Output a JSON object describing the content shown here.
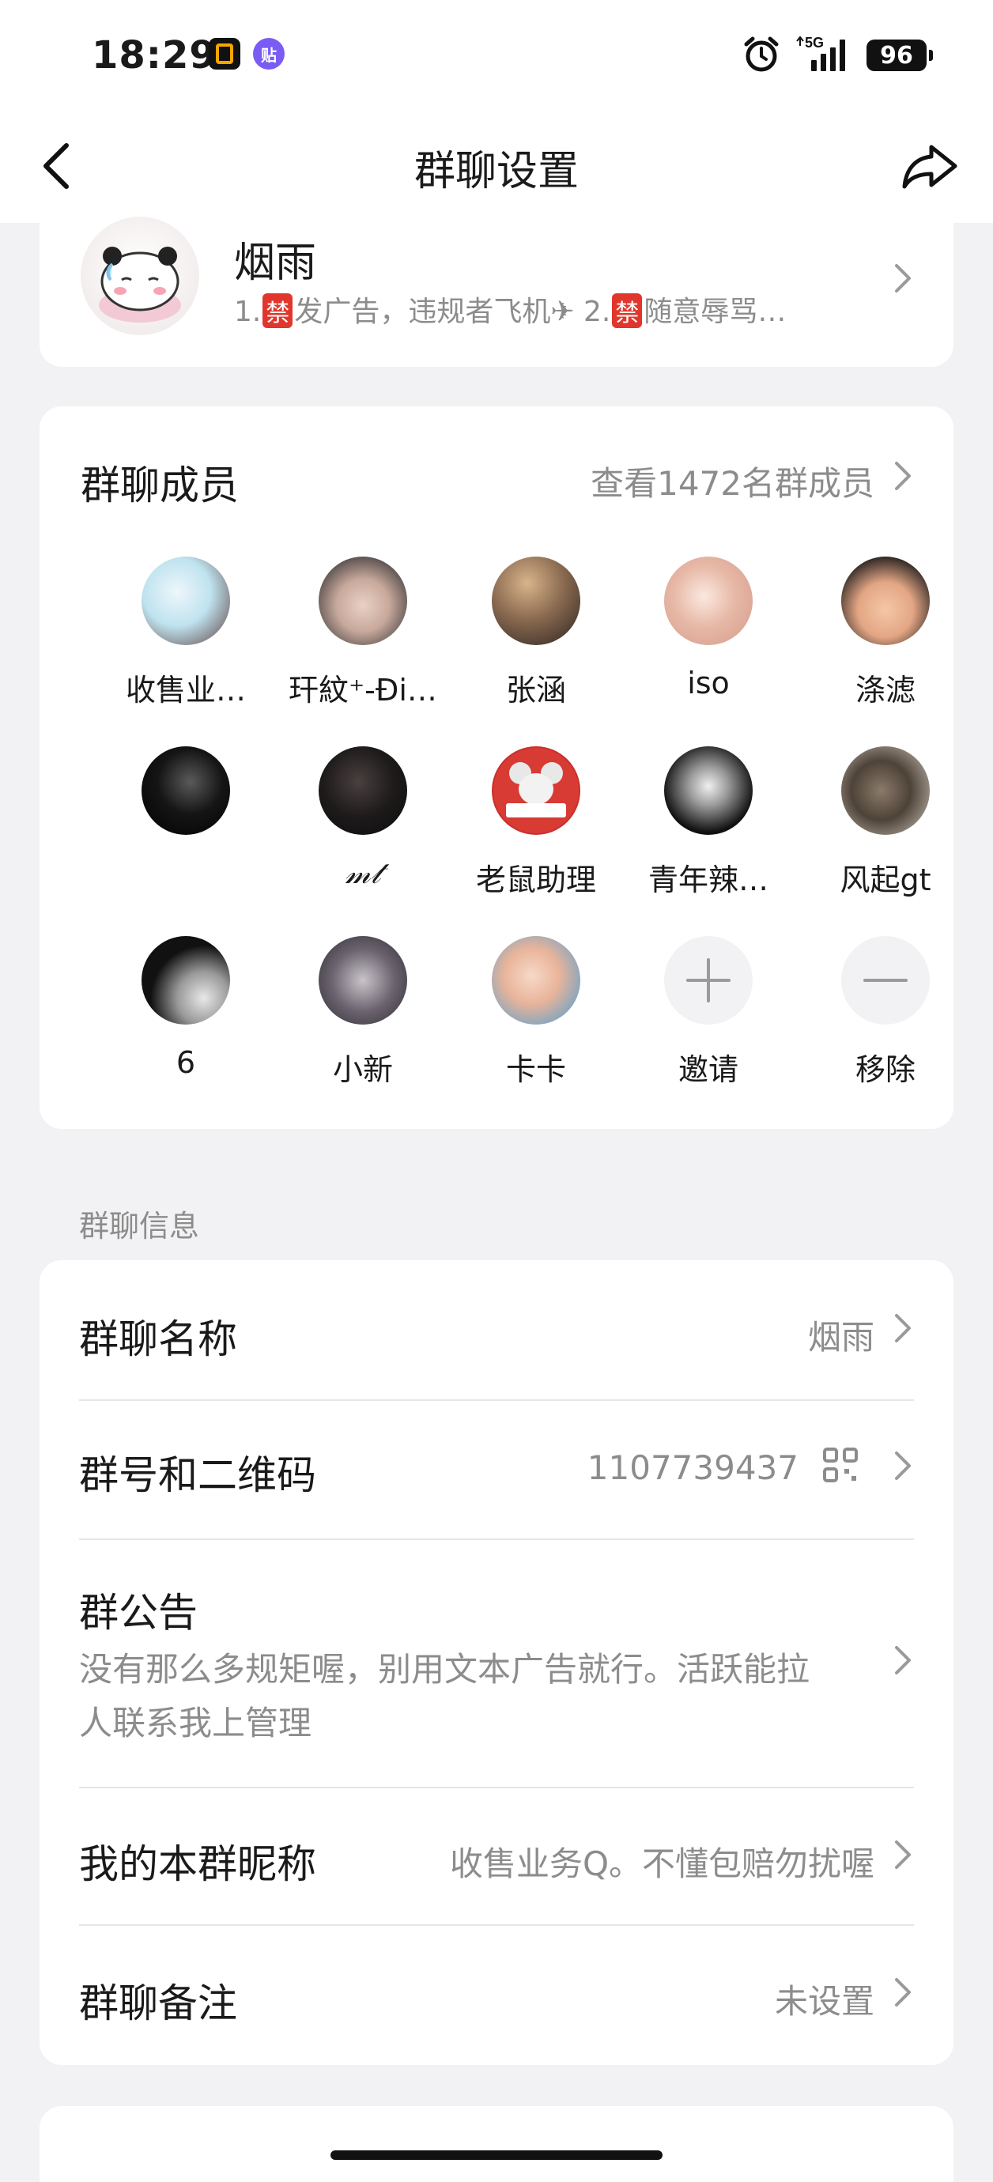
{
  "status": {
    "time": "18:29",
    "battery": "96",
    "network": "5G",
    "badge2": "贴"
  },
  "nav": {
    "title": "群聊设置"
  },
  "group": {
    "name": "烟雨",
    "desc_1": "1.",
    "ban": "禁",
    "desc_2": "发广告，违规者飞机",
    "desc_3": " 2.",
    "desc_4": "随意辱骂…"
  },
  "members": {
    "title": "群聊成员",
    "view_all": "查看1472名群成员",
    "list": [
      {
        "name": "收售业…",
        "icon": "anime-avatar"
      },
      {
        "name": "玕紋⁺-Đi…",
        "icon": "photo-avatar"
      },
      {
        "name": "张涵",
        "icon": "photo-avatar"
      },
      {
        "name": "iso",
        "icon": "anime-avatar"
      },
      {
        "name": "涤滤",
        "icon": "comic-avatar"
      },
      {
        "name": "",
        "icon": "dark-avatar"
      },
      {
        "name": "𝓂𝓉",
        "icon": "dark-avatar"
      },
      {
        "name": "老鼠助理",
        "icon": "mouse-avatar"
      },
      {
        "name": "青年辣…",
        "icon": "anime-avatar"
      },
      {
        "name": "风起gt",
        "icon": "photo-avatar"
      },
      {
        "name": "6",
        "icon": "silhouette-avatar"
      },
      {
        "name": "小新",
        "icon": "anime-avatar"
      },
      {
        "name": "卡卡",
        "icon": "baby-avatar"
      },
      {
        "name": "邀请",
        "icon": "plus-icon"
      },
      {
        "name": "移除",
        "icon": "minus-icon"
      }
    ]
  },
  "info": {
    "section_label": "群聊信息",
    "name_label": "群聊名称",
    "name_value": "烟雨",
    "id_label": "群号和二维码",
    "id_value": "1107739437",
    "notice_label": "群公告",
    "notice_line1": "没有那么多规矩喔，别用文本广告就行。活跃能拉",
    "notice_line2": "人联系我上管理",
    "nickname_label": "我的本群昵称",
    "nickname_value": "收售业务Q。不懂包赔勿扰喔",
    "remark_label": "群聊备注",
    "remark_value": "未设置"
  },
  "colors": {
    "ban_red": "#e0362c",
    "muted": "#8c8c8c",
    "background": "#f2f2f4"
  }
}
